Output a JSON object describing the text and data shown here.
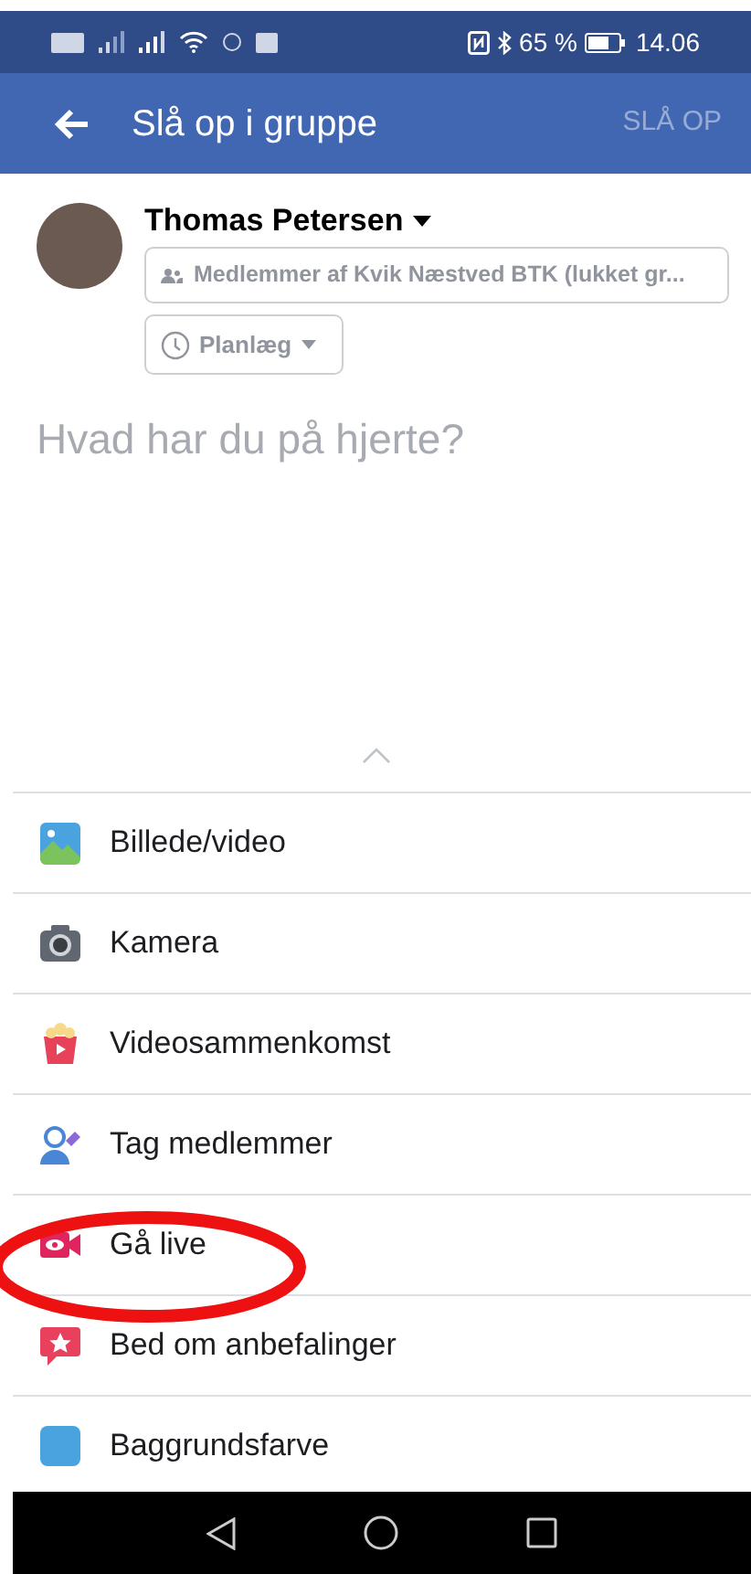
{
  "status_bar": {
    "battery": "65 %",
    "time": "14.06"
  },
  "app_bar": {
    "title": "Slå op i gruppe",
    "action": {
      "label": "SLÅ OP",
      "disabled": true
    }
  },
  "composer": {
    "author": "Thomas Petersen",
    "audience": "Medlemmer af Kvik Næstved BTK (lukket gr...",
    "schedule": "Planlæg",
    "placeholder": "Hvad har du på hjerte?"
  },
  "options": [
    {
      "label": "Billede/video",
      "kind": "photo"
    },
    {
      "label": "Kamera",
      "kind": "camera"
    },
    {
      "label": "Videosammenkomst",
      "kind": "watch"
    },
    {
      "label": "Tag medlemmer",
      "kind": "tag"
    },
    {
      "label": "Gå live",
      "kind": "live"
    },
    {
      "label": "Bed om anbefalinger",
      "kind": "recommend"
    },
    {
      "label": "Baggrundsfarve",
      "kind": "background"
    }
  ]
}
